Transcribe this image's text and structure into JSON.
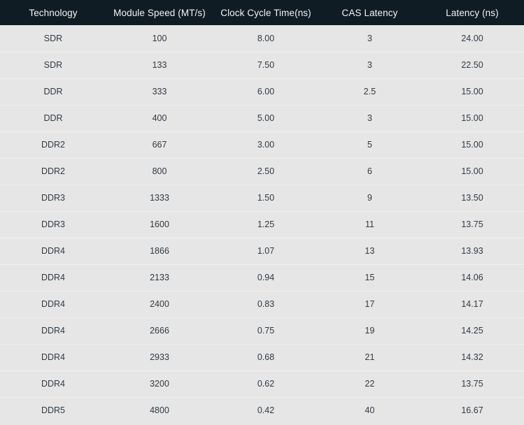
{
  "table": {
    "columns": [
      "Technology",
      "Module Speed (MT/s)",
      "Clock Cycle Time(ns)",
      "CAS Latency",
      "Latency (ns)"
    ],
    "rows": [
      [
        "SDR",
        "100",
        "8.00",
        "3",
        "24.00"
      ],
      [
        "SDR",
        "133",
        "7.50",
        "3",
        "22.50"
      ],
      [
        "DDR",
        "333",
        "6.00",
        "2.5",
        "15.00"
      ],
      [
        "DDR",
        "400",
        "5.00",
        "3",
        "15.00"
      ],
      [
        "DDR2",
        "667",
        "3.00",
        "5",
        "15.00"
      ],
      [
        "DDR2",
        "800",
        "2.50",
        "6",
        "15.00"
      ],
      [
        "DDR3",
        "1333",
        "1.50",
        "9",
        "13.50"
      ],
      [
        "DDR3",
        "1600",
        "1.25",
        "11",
        "13.75"
      ],
      [
        "DDR4",
        "1866",
        "1.07",
        "13",
        "13.93"
      ],
      [
        "DDR4",
        "2133",
        "0.94",
        "15",
        "14.06"
      ],
      [
        "DDR4",
        "2400",
        "0.83",
        "17",
        "14.17"
      ],
      [
        "DDR4",
        "2666",
        "0.75",
        "19",
        "14.25"
      ],
      [
        "DDR4",
        "2933",
        "0.68",
        "21",
        "14.32"
      ],
      [
        "DDR4",
        "3200",
        "0.62",
        "22",
        "13.75"
      ],
      [
        "DDR5",
        "4800",
        "0.42",
        "40",
        "16.67"
      ]
    ]
  },
  "chart_data": {
    "type": "table",
    "title": "",
    "columns": [
      "Technology",
      "Module Speed (MT/s)",
      "Clock Cycle Time(ns)",
      "CAS Latency",
      "Latency (ns)"
    ],
    "rows": [
      [
        "SDR",
        100,
        8.0,
        3,
        24.0
      ],
      [
        "SDR",
        133,
        7.5,
        3,
        22.5
      ],
      [
        "DDR",
        333,
        6.0,
        2.5,
        15.0
      ],
      [
        "DDR",
        400,
        5.0,
        3,
        15.0
      ],
      [
        "DDR2",
        667,
        3.0,
        5,
        15.0
      ],
      [
        "DDR2",
        800,
        2.5,
        6,
        15.0
      ],
      [
        "DDR3",
        1333,
        1.5,
        9,
        13.5
      ],
      [
        "DDR3",
        1600,
        1.25,
        11,
        13.75
      ],
      [
        "DDR4",
        1866,
        1.07,
        13,
        13.93
      ],
      [
        "DDR4",
        2133,
        0.94,
        15,
        14.06
      ],
      [
        "DDR4",
        2400,
        0.83,
        17,
        14.17
      ],
      [
        "DDR4",
        2666,
        0.75,
        19,
        14.25
      ],
      [
        "DDR4",
        2933,
        0.68,
        21,
        14.32
      ],
      [
        "DDR4",
        3200,
        0.62,
        22,
        13.75
      ],
      [
        "DDR5",
        4800,
        0.42,
        40,
        16.67
      ]
    ]
  },
  "colors": {
    "header_background": "#101c24",
    "header_text": "#f2f4f6",
    "row_background": "#e6e6e6",
    "row_divider": "#f0f0f0",
    "cell_text": "#2f3a44"
  }
}
